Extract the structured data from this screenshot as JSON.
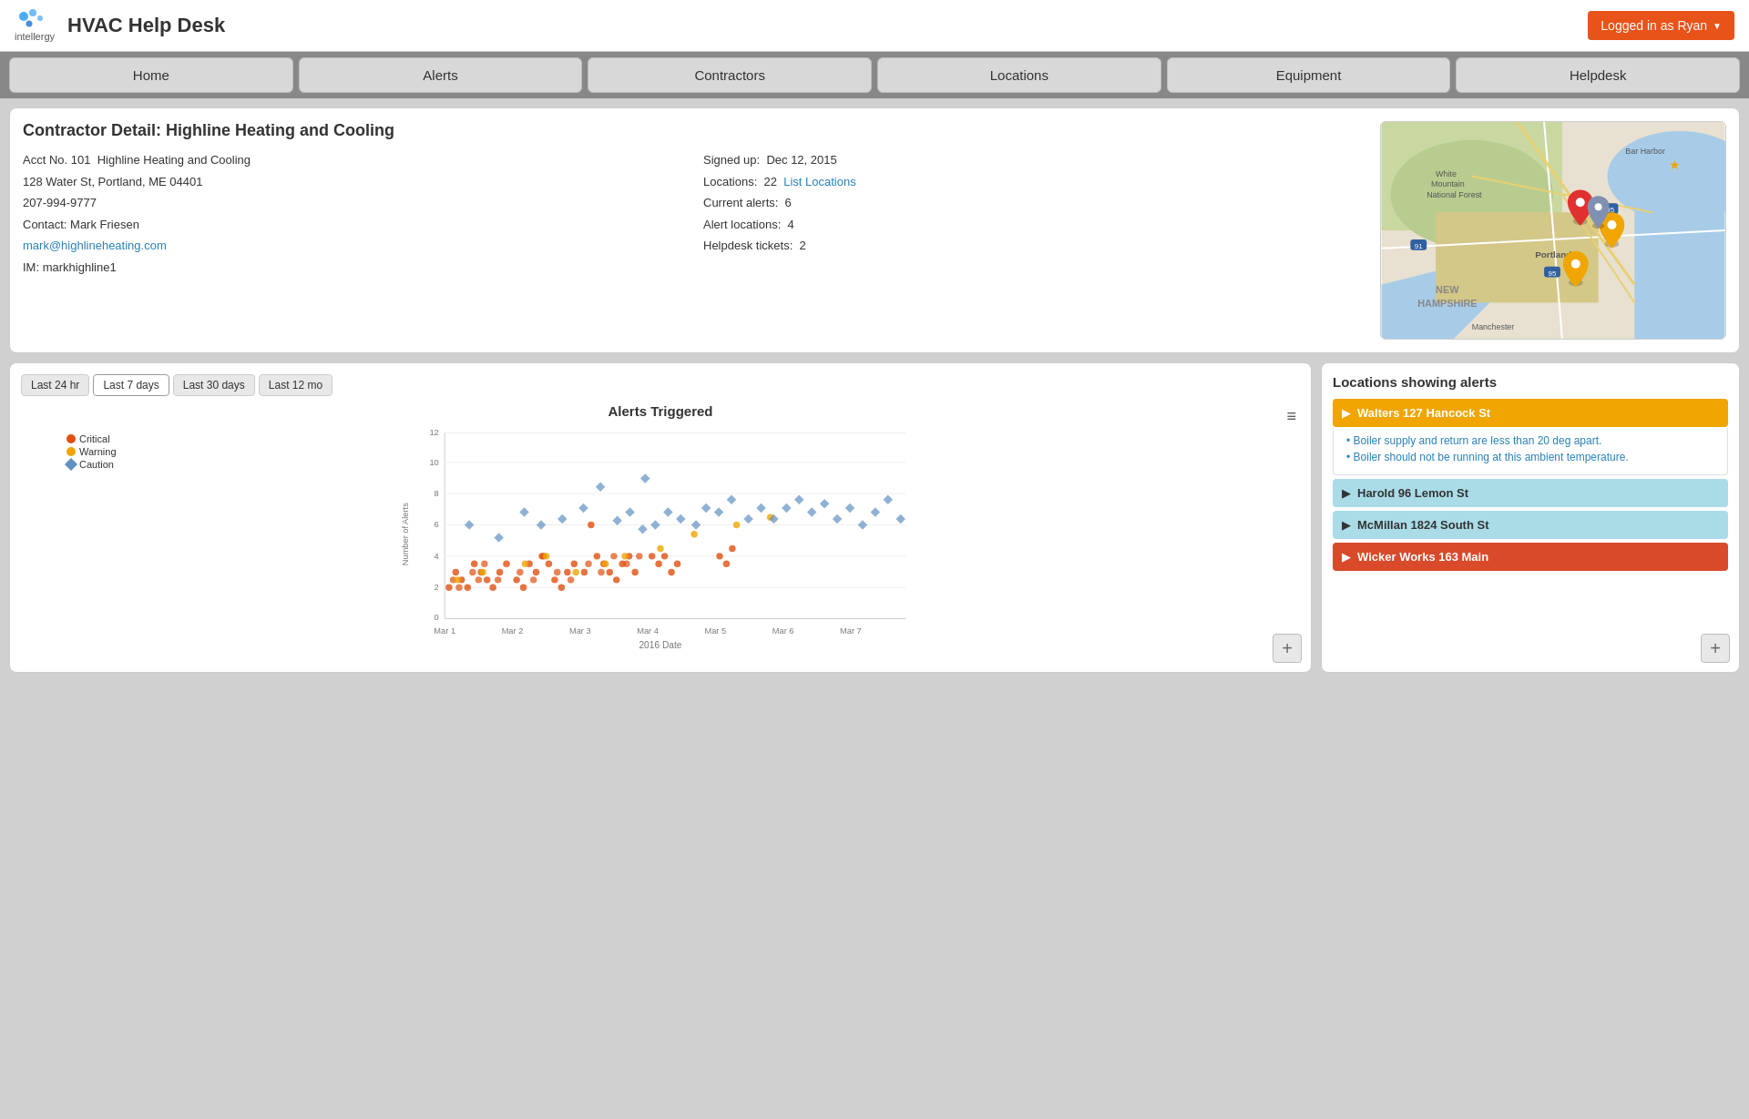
{
  "header": {
    "app_title": "HVAC Help Desk",
    "login_label": "Logged in as Ryan",
    "login_chevron": "▼"
  },
  "nav": {
    "tabs": [
      {
        "label": "Home",
        "id": "home"
      },
      {
        "label": "Alerts",
        "id": "alerts"
      },
      {
        "label": "Contractors",
        "id": "contractors"
      },
      {
        "label": "Locations",
        "id": "locations"
      },
      {
        "label": "Equipment",
        "id": "equipment"
      },
      {
        "label": "Helpdesk",
        "id": "helpdesk"
      }
    ]
  },
  "contractor_detail": {
    "title": "Contractor Detail: Highline Heating and Cooling",
    "acct_no": "Acct No. 101",
    "company": "Highline Heating and Cooling",
    "address": "128 Water St, Portland, ME 04401",
    "phone": "207-994-9777",
    "contact_label": "Contact:",
    "contact_name": "Mark Friesen",
    "email": "mark@highlineheating.com",
    "im_label": "IM:",
    "im": "markhighline1",
    "signed_up_label": "Signed up:",
    "signed_up_value": "Dec 12, 2015",
    "locations_label": "Locations:",
    "locations_value": "22",
    "list_locations_link": "List Locations",
    "current_alerts_label": "Current alerts:",
    "current_alerts_value": "6",
    "alert_locations_label": "Alert locations:",
    "alert_locations_value": "4",
    "helpdesk_tickets_label": "Helpdesk tickets:",
    "helpdesk_tickets_value": "2"
  },
  "chart": {
    "tabs": [
      "Last 24 hr",
      "Last 7 days",
      "Last 30 days",
      "Last 12 mo"
    ],
    "active_tab": 2,
    "title": "Alerts Triggered",
    "menu_icon": "≡",
    "y_axis_label": "Number of Alerts",
    "x_axis_label": "2016 Date",
    "x_labels": [
      "Mar 1",
      "Mar 2",
      "Mar 3",
      "Mar 4",
      "Mar 5",
      "Mar 6",
      "Mar 7"
    ],
    "y_labels": [
      "0",
      "2",
      "4",
      "6",
      "8",
      "10",
      "12"
    ],
    "legend": [
      {
        "label": "Critical",
        "color": "#e05010",
        "shape": "circle"
      },
      {
        "label": "Warning",
        "color": "#f0a500",
        "shape": "circle"
      },
      {
        "label": "Caution",
        "color": "#6090c0",
        "shape": "diamond"
      }
    ],
    "expand_icon": "+"
  },
  "alerts_panel": {
    "title": "Locations showing alerts",
    "locations": [
      {
        "name": "Walters 127 Hancock St",
        "color": "orange",
        "expanded": true,
        "alerts": [
          "Boiler supply and return are less than 20 deg apart.",
          "Boiler should not be running at this ambient temperature."
        ]
      },
      {
        "name": "Harold  96 Lemon St",
        "color": "lightblue",
        "expanded": false,
        "alerts": []
      },
      {
        "name": "McMillan  1824 South St",
        "color": "lightblue",
        "expanded": false,
        "alerts": []
      },
      {
        "name": "Wicker Works  163 Main",
        "color": "red",
        "expanded": false,
        "alerts": []
      }
    ],
    "expand_icon": "+"
  }
}
